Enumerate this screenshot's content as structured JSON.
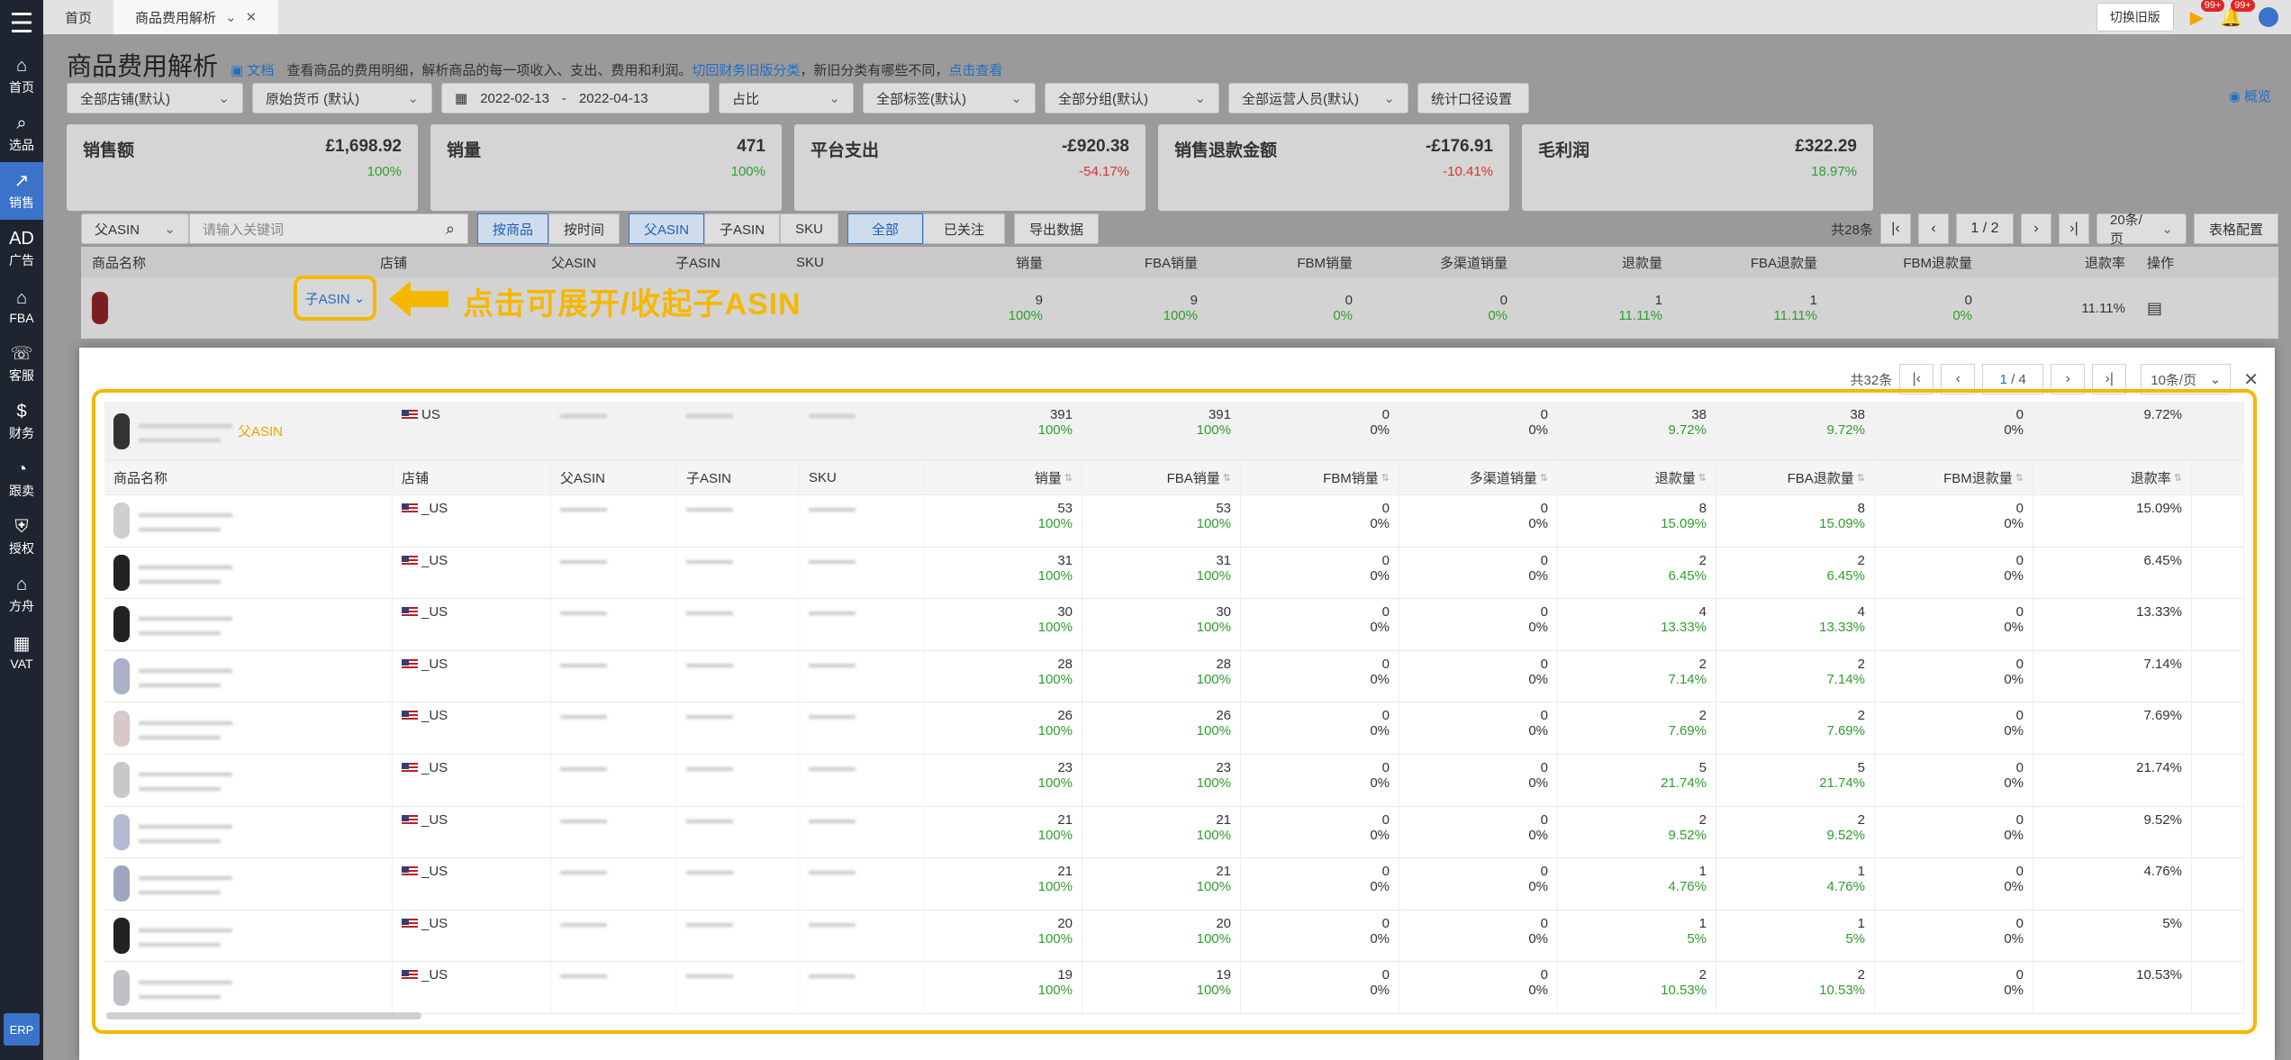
{
  "sidebar": {
    "items": [
      {
        "label": "首页",
        "icon": "home-icon",
        "glyph": "⌂"
      },
      {
        "label": "选品",
        "icon": "search-icon",
        "glyph": "⌕"
      },
      {
        "label": "销售",
        "icon": "chart-line-icon",
        "glyph": "↗"
      },
      {
        "label": "广告",
        "icon": "ad-icon",
        "glyph": "AD"
      },
      {
        "label": "FBA",
        "icon": "warehouse-icon",
        "glyph": "⌂"
      },
      {
        "label": "客服",
        "icon": "service-icon",
        "glyph": "☏"
      },
      {
        "label": "财务",
        "icon": "finance-icon",
        "glyph": "$"
      },
      {
        "label": "跟卖",
        "icon": "follow-sell-icon",
        "glyph": "◔"
      },
      {
        "label": "授权",
        "icon": "shield-icon",
        "glyph": "⛨"
      },
      {
        "label": "方舟",
        "icon": "ark-icon",
        "glyph": "⌂"
      },
      {
        "label": "VAT",
        "icon": "vat-icon",
        "glyph": "▦"
      }
    ],
    "erp_label": "ERP"
  },
  "topbar": {
    "tabs": [
      {
        "label": "首页"
      },
      {
        "label": "商品费用解析"
      }
    ],
    "switch_old": "切换旧版",
    "badge1": "99+",
    "badge2": "99+"
  },
  "header": {
    "title": "商品费用解析",
    "doc": "文档",
    "desc": "查看商品的费用明细，解析商品的每一项收入、支出、费用和利润。",
    "link1": "切回财务旧版分类",
    "desc2": "，新旧分类有哪些不同，",
    "link2": "点击查看"
  },
  "filters": {
    "store": "全部店铺(默认)",
    "currency": "原始货币 (默认)",
    "date_start": "2022-02-13",
    "date_sep": "-",
    "date_end": "2022-04-13",
    "ratio": "占比",
    "tags": "全部标签(默认)",
    "group": "全部分组(默认)",
    "operator": "全部运营人员(默认)",
    "stat_scope": "统计口径设置",
    "overview": "概览"
  },
  "stats": [
    {
      "label": "销售额",
      "value": "£1,698.92",
      "pct": "100%",
      "color": "green"
    },
    {
      "label": "销量",
      "value": "471",
      "pct": "100%",
      "color": "green"
    },
    {
      "label": "平台支出",
      "value": "-£920.38",
      "pct": "-54.17%",
      "color": "red"
    },
    {
      "label": "销售退款金额",
      "value": "-£176.91",
      "pct": "-10.41%",
      "color": "red"
    },
    {
      "label": "毛利润",
      "value": "£322.29",
      "pct": "18.97%",
      "color": "green"
    }
  ],
  "toolbar": {
    "asin_type": "父ASIN",
    "search_placeholder": "请输入关键词",
    "by_product": "按商品",
    "by_time": "按时间",
    "parent_asin": "父ASIN",
    "child_asin": "子ASIN",
    "sku": "SKU",
    "all": "全部",
    "followed": "已关注",
    "export": "导出数据",
    "total": "共28条",
    "page": "1",
    "pages": "/ 2",
    "page_size": "20条/页",
    "table_config": "表格配置"
  },
  "bg_table": {
    "headers": [
      "商品名称",
      "店铺",
      "父ASIN",
      "子ASIN",
      "SKU",
      "销量",
      "FBA销量",
      "FBM销量",
      "多渠道销量",
      "退款量",
      "FBA退款量",
      "FBM退款量",
      "退款率",
      "操作"
    ],
    "row": {
      "toggle": "子ASIN",
      "vals": [
        "9",
        "9",
        "0",
        "0",
        "1",
        "1",
        "0",
        "11.11%"
      ],
      "pcts": [
        "100%",
        "100%",
        "0%",
        "0%",
        "11.11%",
        "11.11%",
        "0%",
        ""
      ]
    }
  },
  "callout": {
    "text": "点击可展开/收起子ASIN"
  },
  "modal": {
    "total": "共32条",
    "page": "1",
    "pages": "/ 4",
    "page_size": "10条/页",
    "parent": {
      "tag": "父ASIN",
      "store": "US",
      "vals": [
        "391",
        "391",
        "0",
        "0",
        "38",
        "38",
        "0",
        "9.72%"
      ],
      "pcts": [
        "100%",
        "100%",
        "0%",
        "0%",
        "9.72%",
        "9.72%",
        "0%"
      ]
    },
    "headers": [
      "商品名称",
      "店铺",
      "父ASIN",
      "子ASIN",
      "SKU",
      "销量",
      "FBA销量",
      "FBM销量",
      "多渠道销量",
      "退款量",
      "FBA退款量",
      "FBM退款量",
      "退款率"
    ],
    "rows": [
      {
        "store": "_US",
        "thumb": "#cfcfcf",
        "vals": [
          "53",
          "53",
          "0",
          "0",
          "8",
          "8",
          "0",
          "15.09%"
        ],
        "pcts": [
          "100%",
          "100%",
          "0%",
          "0%",
          "15.09%",
          "15.09%",
          "0%"
        ]
      },
      {
        "store": "_US",
        "thumb": "#222",
        "vals": [
          "31",
          "31",
          "0",
          "0",
          "2",
          "2",
          "0",
          "6.45%"
        ],
        "pcts": [
          "100%",
          "100%",
          "0%",
          "0%",
          "6.45%",
          "6.45%",
          "0%"
        ]
      },
      {
        "store": "_US",
        "thumb": "#222",
        "vals": [
          "30",
          "30",
          "0",
          "0",
          "4",
          "4",
          "0",
          "13.33%"
        ],
        "pcts": [
          "100%",
          "100%",
          "0%",
          "0%",
          "13.33%",
          "13.33%",
          "0%"
        ]
      },
      {
        "store": "_US",
        "thumb": "#a9b0c8",
        "vals": [
          "28",
          "28",
          "0",
          "0",
          "2",
          "2",
          "0",
          "7.14%"
        ],
        "pcts": [
          "100%",
          "100%",
          "0%",
          "0%",
          "7.14%",
          "7.14%",
          "0%"
        ]
      },
      {
        "store": "_US",
        "thumb": "#d8c8c8",
        "vals": [
          "26",
          "26",
          "0",
          "0",
          "2",
          "2",
          "0",
          "7.69%"
        ],
        "pcts": [
          "100%",
          "100%",
          "0%",
          "0%",
          "7.69%",
          "7.69%",
          "0%"
        ]
      },
      {
        "store": "_US",
        "thumb": "#c8c8c8",
        "vals": [
          "23",
          "23",
          "0",
          "0",
          "5",
          "5",
          "0",
          "21.74%"
        ],
        "pcts": [
          "100%",
          "100%",
          "0%",
          "0%",
          "21.74%",
          "21.74%",
          "0%"
        ]
      },
      {
        "store": "_US",
        "thumb": "#b4bcd4",
        "vals": [
          "21",
          "21",
          "0",
          "0",
          "2",
          "2",
          "0",
          "9.52%"
        ],
        "pcts": [
          "100%",
          "100%",
          "0%",
          "0%",
          "9.52%",
          "9.52%",
          "0%"
        ]
      },
      {
        "store": "_US",
        "thumb": "#9ea6c2",
        "vals": [
          "21",
          "21",
          "0",
          "0",
          "1",
          "1",
          "0",
          "4.76%"
        ],
        "pcts": [
          "100%",
          "100%",
          "0%",
          "0%",
          "4.76%",
          "4.76%",
          "0%"
        ]
      },
      {
        "store": "_US",
        "thumb": "#222",
        "vals": [
          "20",
          "20",
          "0",
          "0",
          "1",
          "1",
          "0",
          "5%"
        ],
        "pcts": [
          "100%",
          "100%",
          "0%",
          "0%",
          "5%",
          "5%",
          "0%"
        ]
      },
      {
        "store": "_US",
        "thumb": "#c0c0c8",
        "vals": [
          "19",
          "19",
          "0",
          "0",
          "2",
          "2",
          "0",
          "10.53%"
        ],
        "pcts": [
          "100%",
          "100%",
          "0%",
          "0%",
          "10.53%",
          "10.53%",
          "0%"
        ]
      }
    ]
  }
}
